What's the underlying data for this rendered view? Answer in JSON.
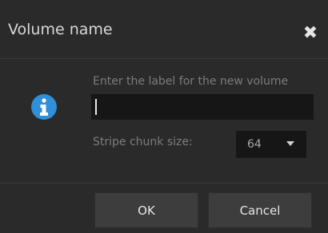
{
  "dialog": {
    "title": "Volume name",
    "close_icon": "close-icon",
    "prompt": "Enter the label for the new volume",
    "label_input_value": "",
    "stripe_label": "Stripe chunk size:",
    "stripe_select_value": "64",
    "info_icon": "info-icon",
    "ok_label": "OK",
    "cancel_label": "Cancel"
  },
  "colors": {
    "background": "#2a2a2a",
    "input_background": "#161616",
    "button_background": "#3d3d3d",
    "info_icon": "#2f8fd8",
    "muted_text": "#7c7c7c"
  }
}
